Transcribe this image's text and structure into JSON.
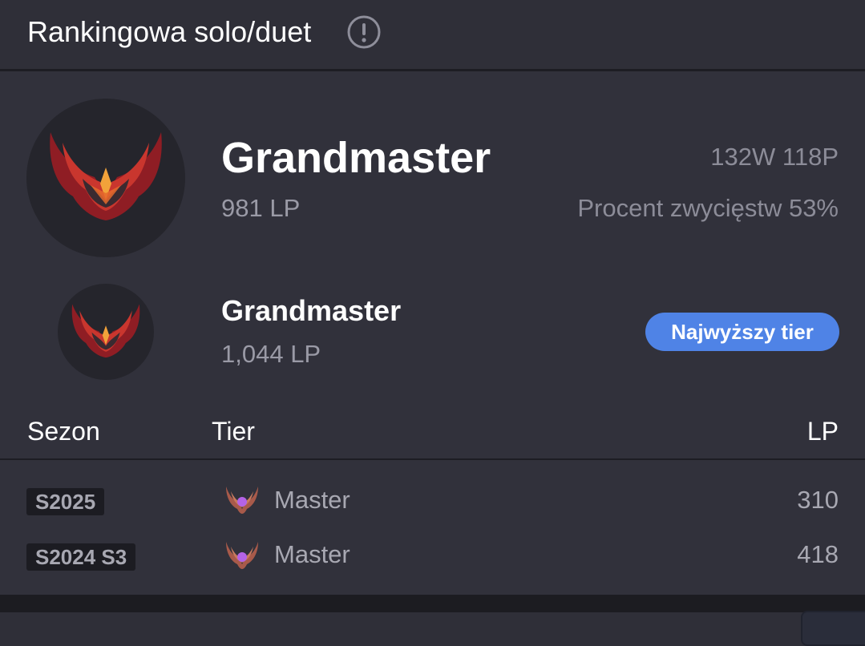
{
  "header": {
    "title": "Rankingowa solo/duet",
    "info_icon": "exclamation-circle-icon"
  },
  "current": {
    "tier": "Grandmaster",
    "lp": "981 LP",
    "record": "132W 118P",
    "winrate": "Procent zwycięstw 53%",
    "emblem_icon": "grandmaster-emblem-icon"
  },
  "peak": {
    "tier": "Grandmaster",
    "lp": "1,044 LP",
    "badge": "Najwyższy tier",
    "emblem_icon": "grandmaster-emblem-icon"
  },
  "history": {
    "headers": {
      "season": "Sezon",
      "tier": "Tier",
      "lp": "LP"
    },
    "rows": [
      {
        "season": "S2025",
        "tier": "Master",
        "lp": "310",
        "icon": "master-emblem-icon"
      },
      {
        "season": "S2024 S3",
        "tier": "Master",
        "lp": "418",
        "icon": "master-emblem-icon"
      }
    ]
  },
  "colors": {
    "background": "#2f2f38",
    "badge": "#4f83e6",
    "muted_text": "#9a9aa6"
  }
}
